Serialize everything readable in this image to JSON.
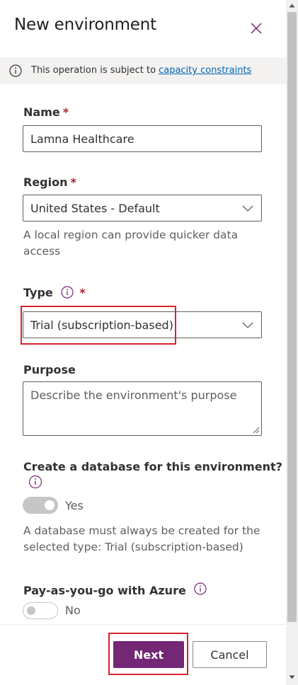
{
  "panel": {
    "title": "New environment",
    "banner": {
      "text": "This operation is subject to",
      "link": "capacity constraints"
    },
    "name": {
      "label": "Name",
      "required_mark": "*",
      "value": "Lamna Healthcare"
    },
    "region": {
      "label": "Region",
      "required_mark": "*",
      "value": "United States - Default",
      "help": "A local region can provide quicker data access"
    },
    "type": {
      "label": "Type",
      "required_mark": "*",
      "value": "Trial (subscription-based)"
    },
    "purpose": {
      "label": "Purpose",
      "placeholder": "Describe the environment's purpose"
    },
    "database": {
      "label": "Create a database for this environment?",
      "toggle_label": "Yes",
      "toggle_on": true,
      "help": "A database must always be created for the selected type: Trial (subscription-based)"
    },
    "payg": {
      "label": "Pay-as-you-go with Azure",
      "toggle_label": "No",
      "toggle_on": false
    },
    "footer": {
      "next_label": "Next",
      "cancel_label": "Cancel"
    }
  },
  "colors": {
    "brand": "#742774",
    "required": "#a4262c",
    "link": "#0063b1",
    "highlight": "#d9232e"
  },
  "icons": [
    "close-icon",
    "info-icon",
    "chevron-down-icon",
    "resize-grip-icon"
  ]
}
